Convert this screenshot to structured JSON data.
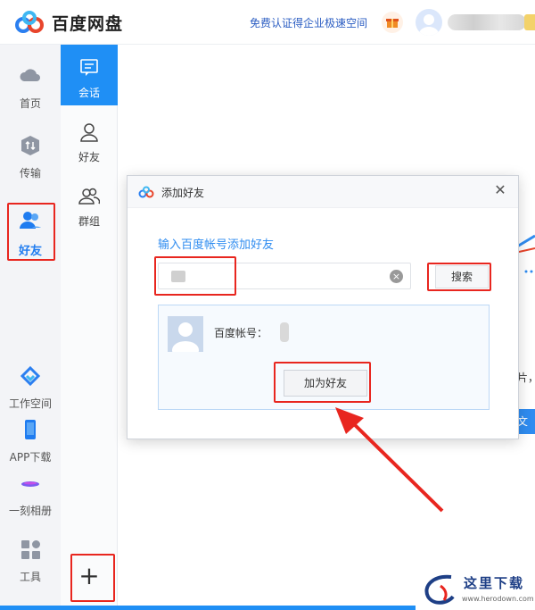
{
  "header": {
    "app_name": "百度网盘",
    "promo_link": "免费认证得企业极速空间"
  },
  "sidebar": {
    "items": [
      {
        "label": "首页",
        "icon": "cloud-icon"
      },
      {
        "label": "传输",
        "icon": "transfer-icon"
      },
      {
        "label": "好友",
        "icon": "friends-icon",
        "active": true
      },
      {
        "label": "工作空间",
        "icon": "workspace-icon"
      },
      {
        "label": "APP下载",
        "icon": "phone-icon"
      },
      {
        "label": "一刻相册",
        "icon": "album-icon"
      },
      {
        "label": "工具",
        "icon": "tools-icon"
      }
    ]
  },
  "subnav": {
    "items": [
      {
        "label": "会话",
        "icon": "chat-icon",
        "active": true
      },
      {
        "label": "好友",
        "icon": "person-icon"
      },
      {
        "label": "群组",
        "icon": "group-icon"
      }
    ],
    "add_label": "+"
  },
  "dialog": {
    "title": "添加好友",
    "close_label": "✕",
    "prompt": "输入百度帐号添加好友",
    "search_button": "搜索",
    "result_label": "百度帐号：",
    "add_button": "加为好友"
  },
  "main": {
    "clipped_text_1": "片，",
    "clipped_text_2": "文化"
  },
  "watermark": {
    "text": "这里下载",
    "url": "www.herodown.com"
  },
  "colors": {
    "accent": "#1f8ff5",
    "highlight": "#e8261f",
    "link": "#2a5cc2"
  }
}
